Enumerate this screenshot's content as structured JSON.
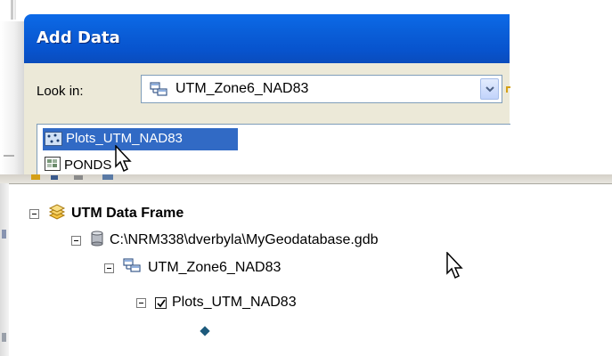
{
  "dialog": {
    "title": "Add Data",
    "look_in_label": "Look in:",
    "look_in_value": "UTM_Zone6_NAD83",
    "items": [
      {
        "label": "Plots_UTM_NAD83",
        "icon": "point-feature-class-icon",
        "selected": true
      },
      {
        "label": "PONDS",
        "icon": "raster-icon",
        "selected": false
      }
    ],
    "colors": {
      "titlebar": "#0a5fd9",
      "selection": "#316ac5",
      "body": "#ece9d8"
    }
  },
  "toc": {
    "frame": {
      "label": "UTM Data Frame",
      "icon": "layers-icon"
    },
    "geodatabase": {
      "label": "C:\\NRM338\\dverbyla\\MyGeodatabase.gdb",
      "icon": "geodatabase-icon"
    },
    "dataset": {
      "label": "UTM_Zone6_NAD83",
      "icon": "feature-dataset-icon"
    },
    "layer": {
      "label": "Plots_UTM_NAD83",
      "checked": true
    },
    "symbol_color": "#1d5a7c"
  }
}
